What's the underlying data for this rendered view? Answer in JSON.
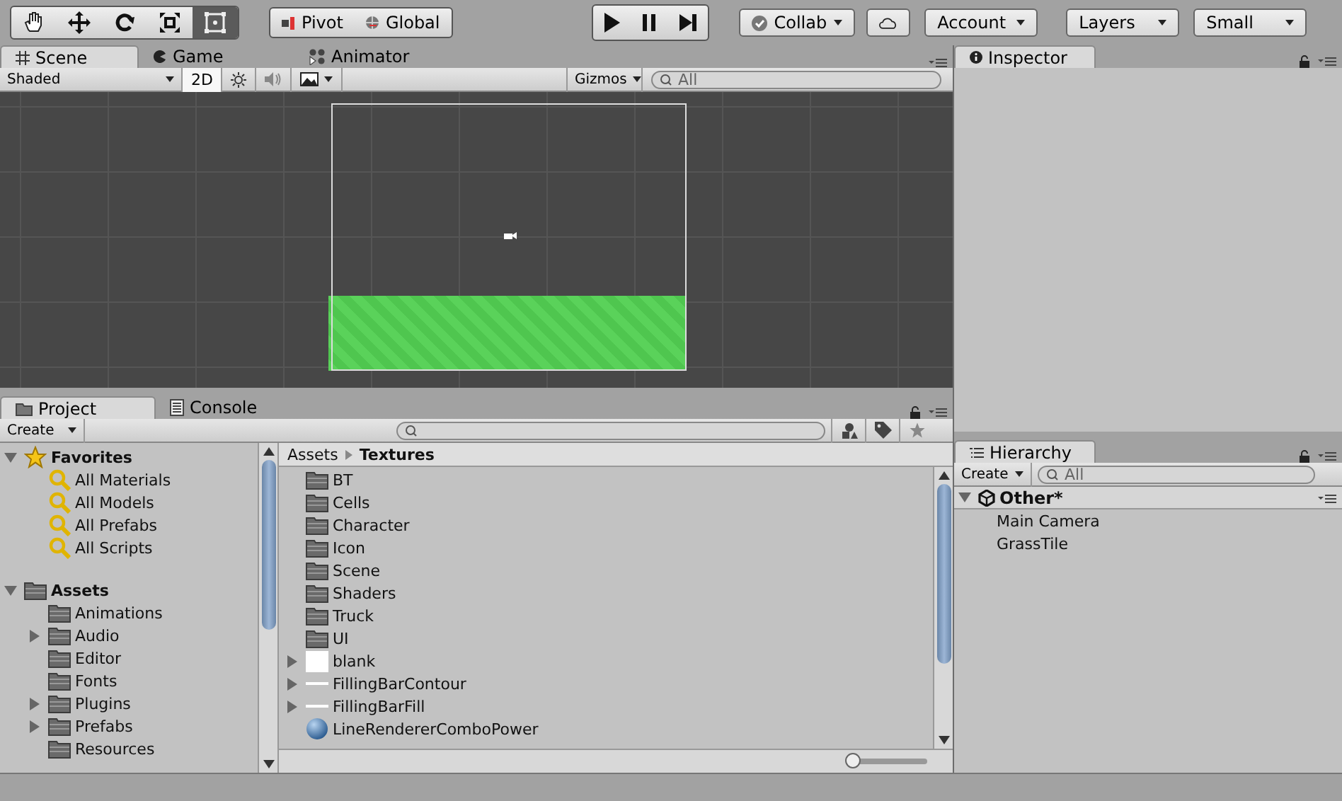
{
  "toolbar": {
    "tools": [
      {
        "kind": "hand",
        "selected": false
      },
      {
        "kind": "move",
        "selected": false
      },
      {
        "kind": "rotate",
        "selected": false
      },
      {
        "kind": "scale",
        "selected": false
      },
      {
        "kind": "rect",
        "selected": true
      }
    ],
    "pivot": [
      {
        "kind": "pivot",
        "label": "Pivot"
      },
      {
        "kind": "global",
        "label": "Global"
      }
    ],
    "play": [
      {
        "kind": "play",
        "on": false
      },
      {
        "kind": "pause",
        "on": false
      },
      {
        "kind": "step",
        "on": false
      }
    ],
    "collab": "Collab",
    "account": "Account",
    "layers": "Layers",
    "layout": "Small"
  },
  "scene_panel": {
    "tabs": [
      {
        "kind": "scene",
        "label": "Scene",
        "selected": true
      },
      {
        "kind": "game",
        "label": "Game",
        "selected": false
      },
      {
        "kind": "animator",
        "label": "Animator",
        "selected": false
      }
    ],
    "shading": "Shaded",
    "mode_2d": {
      "label": "2D",
      "on": true
    },
    "audio": {
      "on": false
    },
    "gizmos": "Gizmos",
    "search": {
      "placeholder": "All"
    }
  },
  "inspector": {
    "tab": "Inspector"
  },
  "project_panel": {
    "tabs": [
      {
        "kind": "project",
        "label": "Project",
        "selected": true
      },
      {
        "kind": "console",
        "label": "Console",
        "selected": false
      }
    ],
    "create": "Create",
    "tree": [
      {
        "kind": "favorites",
        "label": "Favorites",
        "expanded": true,
        "children": [
          {
            "kind": "search",
            "label": "All Materials",
            "expandable": false
          },
          {
            "kind": "search",
            "label": "All Models",
            "expandable": false
          },
          {
            "kind": "search",
            "label": "All Prefabs",
            "expandable": false
          },
          {
            "kind": "search",
            "label": "All Scripts",
            "expandable": false
          }
        ]
      },
      {
        "kind": "folder",
        "label": "Assets",
        "expanded": true,
        "children": [
          {
            "kind": "folder",
            "label": "Animations",
            "expandable": false
          },
          {
            "kind": "folder",
            "label": "Audio",
            "expandable": true
          },
          {
            "kind": "folder",
            "label": "Editor",
            "expandable": false
          },
          {
            "kind": "folder",
            "label": "Fonts",
            "expandable": false
          },
          {
            "kind": "folder",
            "label": "Plugins",
            "expandable": true
          },
          {
            "kind": "folder",
            "label": "Prefabs",
            "expandable": true
          },
          {
            "kind": "folder",
            "label": "Resources",
            "expandable": false
          }
        ]
      }
    ],
    "breadcrumb": [
      "Assets",
      "Textures"
    ],
    "items": [
      {
        "kind": "folder",
        "label": "BT",
        "expandable": false
      },
      {
        "kind": "folder",
        "label": "Cells",
        "expandable": false
      },
      {
        "kind": "folder",
        "label": "Character",
        "expandable": false
      },
      {
        "kind": "folder",
        "label": "Icon",
        "expandable": false
      },
      {
        "kind": "folder",
        "label": "Scene",
        "expandable": false
      },
      {
        "kind": "folder",
        "label": "Shaders",
        "expandable": false
      },
      {
        "kind": "folder",
        "label": "Truck",
        "expandable": false
      },
      {
        "kind": "folder",
        "label": "UI",
        "expandable": false
      },
      {
        "kind": "texture",
        "label": "blank",
        "expandable": true
      },
      {
        "kind": "strip",
        "label": "FillingBarContour",
        "expandable": true
      },
      {
        "kind": "strip",
        "label": "FillingBarFill",
        "expandable": true
      },
      {
        "kind": "material",
        "label": "LineRendererComboPower",
        "expandable": false
      }
    ],
    "icon_size": {
      "level": 0
    }
  },
  "hierarchy": {
    "tab": "Hierarchy",
    "create": "Create",
    "search": {
      "placeholder": "All"
    },
    "scene": {
      "label": "Other*",
      "expanded": true
    },
    "objects": [
      "Main Camera",
      "GrassTile"
    ]
  }
}
